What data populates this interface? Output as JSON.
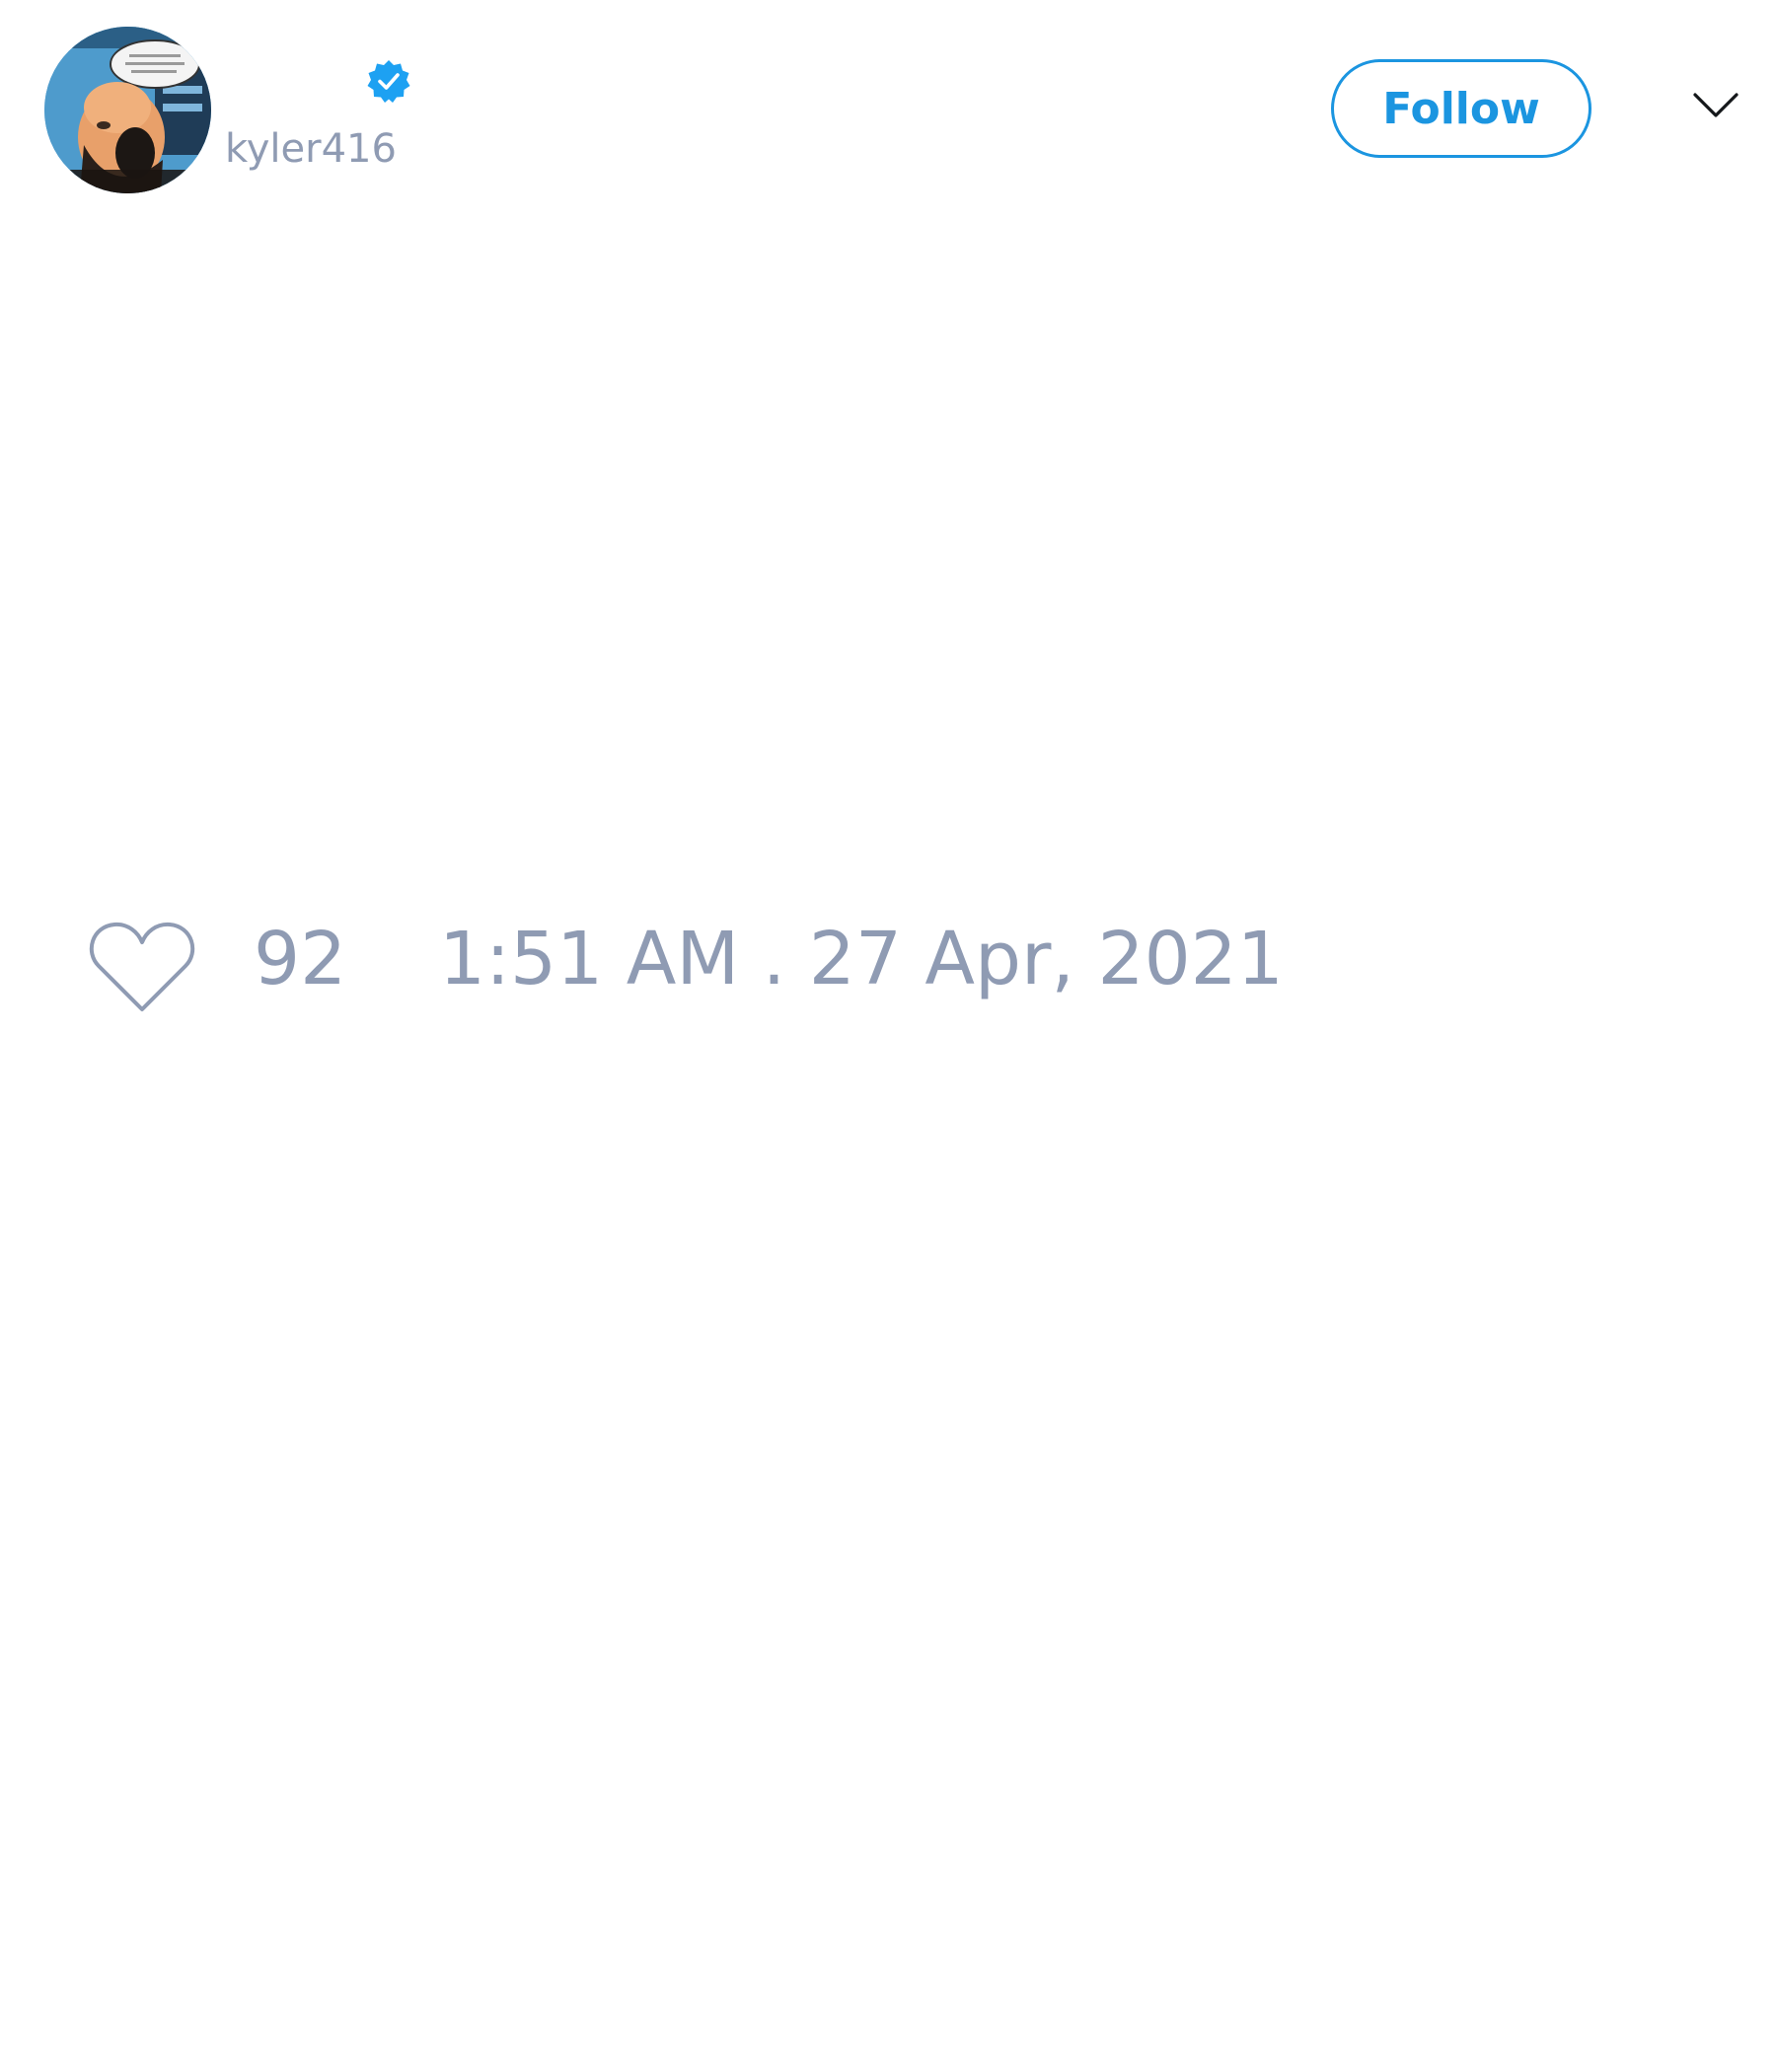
{
  "author": {
    "display_name": "",
    "username": "kyler416",
    "verified": true,
    "avatar_icon": "comic-panel-avatar"
  },
  "header": {
    "follow_label": "Follow",
    "menu_icon": "chevron-down-icon"
  },
  "footer": {
    "like_icon": "heart-icon",
    "like_count": "92",
    "timestamp": "1:51 AM . 27 Apr, 2021"
  },
  "colors": {
    "accent": "#1b95e0",
    "verified_badge": "#1da1f2",
    "muted_text": "#8f9bb3",
    "background": "#ffffff"
  }
}
